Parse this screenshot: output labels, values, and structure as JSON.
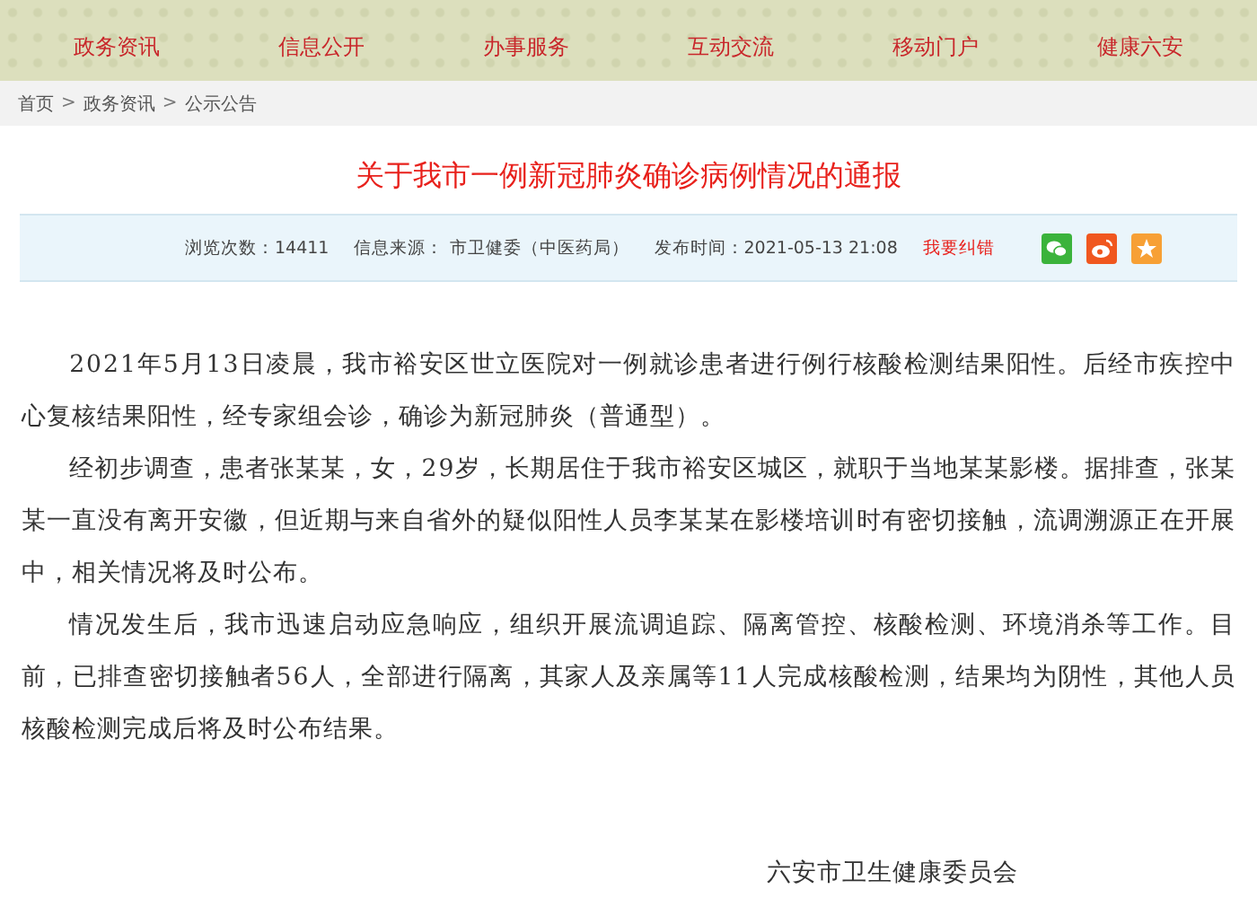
{
  "nav": [
    {
      "label": "政务资讯"
    },
    {
      "label": "信息公开"
    },
    {
      "label": "办事服务"
    },
    {
      "label": "互动交流"
    },
    {
      "label": "移动门户"
    },
    {
      "label": "健康六安"
    }
  ],
  "breadcrumb": [
    "首页",
    "政务资讯",
    "公示公告"
  ],
  "breadcrumb_separator": ">",
  "article": {
    "title": "关于我市一例新冠肺炎确诊病例情况的通报",
    "meta": [
      {
        "kind": "text",
        "text": "浏览次数：14411"
      },
      {
        "kind": "text",
        "text": "信息来源：  市卫健委（中医药局）"
      },
      {
        "kind": "text",
        "text": "发布时间：2021-05-13 21:08"
      },
      {
        "kind": "link",
        "text": "我要纠错"
      }
    ],
    "share": [
      {
        "kind": "wechat",
        "color": "#3bb33b"
      },
      {
        "kind": "weibo",
        "color": "#f0571f"
      },
      {
        "kind": "favorite",
        "color": "#f7a035"
      }
    ],
    "paragraphs": [
      "2021年5月13日凌晨，我市裕安区世立医院对一例就诊患者进行例行核酸检测结果阳性。后经市疾控中心复核结果阳性，经专家组会诊，确诊为新冠肺炎（普通型）。",
      "经初步调查，患者张某某，女，29岁，长期居住于我市裕安区城区，就职于当地某某影楼。据排查，张某某一直没有离开安徽，但近期与来自省外的疑似阳性人员李某某在影楼培训时有密切接触，流调溯源正在开展中，相关情况将及时公布。",
      "情况发生后，我市迅速启动应急响应，组织开展流调追踪、隔离管控、核酸检测、环境消杀等工作。目前，已排查密切接触者56人，全部进行隔离，其家人及亲属等11人完成核酸检测，结果均为阴性，其他人员核酸检测完成后将及时公布结果。"
    ],
    "signature": "六安市卫生健康委员会"
  }
}
